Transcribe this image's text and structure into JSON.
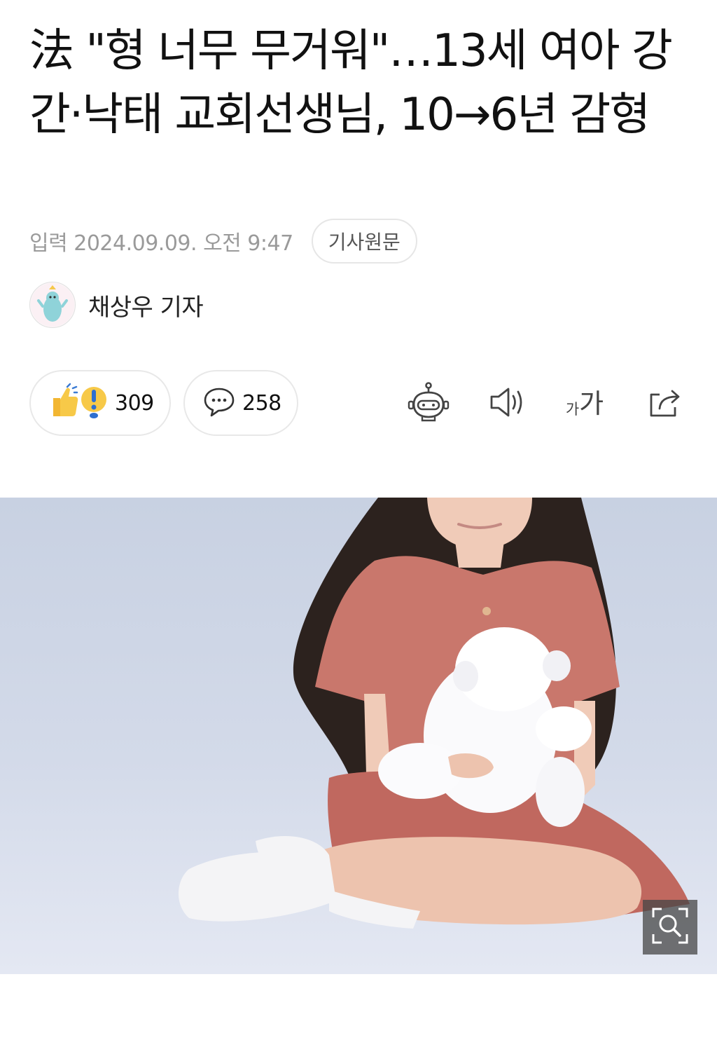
{
  "article": {
    "title": "法 \"형 너무 무거워\"…13세 여아 강간·낙태 교회선생님, 10→6년 감형",
    "date": "입력 2024.09.09. 오전 9:47",
    "original_button": "기사원문",
    "author": "채상우 기자"
  },
  "reactions": {
    "count": "309",
    "icon": "thumbs-up-exclamation-icon"
  },
  "comments": {
    "count": "258",
    "icon": "speech-bubble-icon"
  },
  "toolbar": {
    "items": [
      "robot-summary-icon",
      "speaker-icon",
      "font-size-icon",
      "share-icon"
    ],
    "font_size_label_small": "가",
    "font_size_label_large": "가"
  },
  "photo": {
    "icon": "zoom-search-icon"
  },
  "colors": {
    "photo_background": "#c9d2e3",
    "dress": "#c9776c",
    "border": "#e6e6e6",
    "meta_text": "#9a9a9a"
  }
}
